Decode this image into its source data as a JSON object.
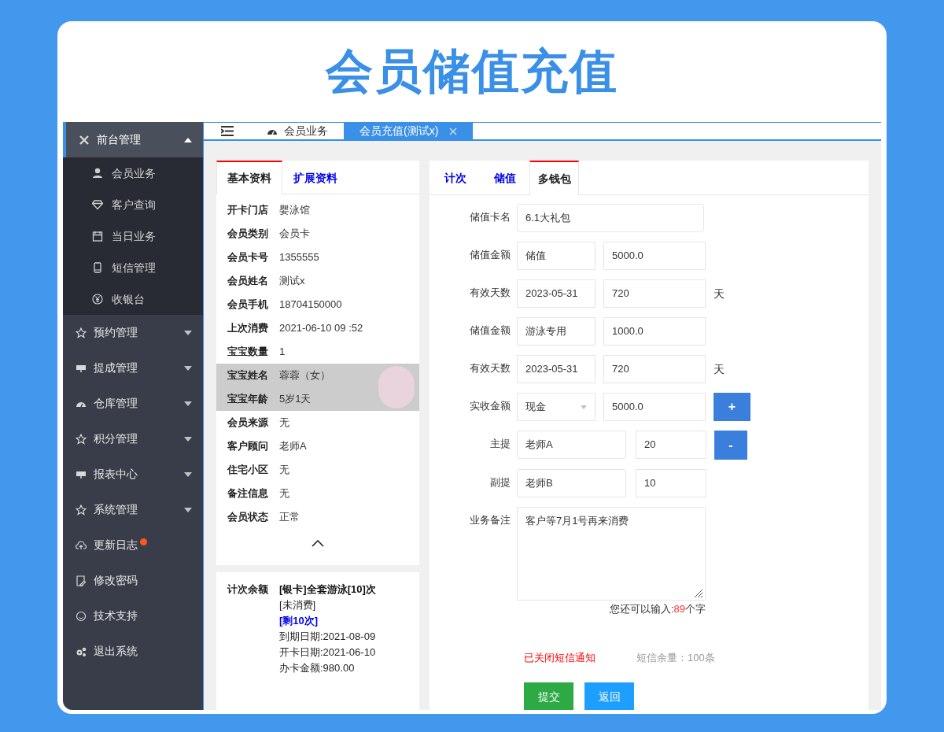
{
  "title": "会员储值充值",
  "sidebar": {
    "items": [
      {
        "label": "前台管理",
        "expanded": true,
        "dot": false,
        "children": [
          {
            "label": "会员业务"
          },
          {
            "label": "客户查询"
          },
          {
            "label": "当日业务"
          },
          {
            "label": "短信管理"
          },
          {
            "label": "收银台"
          }
        ]
      },
      {
        "label": "预约管理",
        "expanded": false,
        "dot": false
      },
      {
        "label": "提成管理",
        "expanded": false,
        "dot": false
      },
      {
        "label": "仓库管理",
        "expanded": false,
        "dot": false
      },
      {
        "label": "积分管理",
        "expanded": false,
        "dot": false
      },
      {
        "label": "报表中心",
        "expanded": false,
        "dot": false
      },
      {
        "label": "系统管理",
        "expanded": false,
        "dot": false
      },
      {
        "label": "更新日志",
        "dot": true
      },
      {
        "label": "修改密码",
        "dot": false
      },
      {
        "label": "技术支持",
        "dot": false
      },
      {
        "label": "退出系统",
        "dot": false
      }
    ]
  },
  "tabs": [
    {
      "label": "会员业务",
      "selected": false,
      "closable": false
    },
    {
      "label": "会员充值(测试x)",
      "selected": true,
      "closable": true
    }
  ],
  "member_panel": {
    "tabs": [
      {
        "label": "基本资料",
        "selected": true
      },
      {
        "label": "扩展资料",
        "selected": false
      }
    ],
    "fields": [
      {
        "label": "开卡门店",
        "value": "婴泳馆",
        "highlighted": false
      },
      {
        "label": "会员类别",
        "value": "会员卡",
        "highlighted": false
      },
      {
        "label": "会员卡号",
        "value": "1355555",
        "highlighted": false
      },
      {
        "label": "会员姓名",
        "value": "测试x",
        "highlighted": false
      },
      {
        "label": "会员手机",
        "value": "18704150000",
        "highlighted": false
      },
      {
        "label": "上次消费",
        "value": "2021-06-10 09 :52",
        "highlighted": false
      },
      {
        "label": "宝宝数量",
        "value": "1",
        "highlighted": false
      },
      {
        "label": "宝宝姓名",
        "value": "蓉蓉（女）",
        "highlighted": true
      },
      {
        "label": "宝宝年龄",
        "value": "5岁1天",
        "highlighted": true
      },
      {
        "label": "会员来源",
        "value": "无",
        "highlighted": false
      },
      {
        "label": "客户顾问",
        "value": "老师A",
        "highlighted": false
      },
      {
        "label": "住宅小区",
        "value": "无",
        "highlighted": false
      },
      {
        "label": "备注信息",
        "value": "无",
        "highlighted": false
      },
      {
        "label": "会员状态",
        "value": "正常",
        "highlighted": false
      }
    ],
    "balance": {
      "label": "计次余额",
      "lines": [
        {
          "text": "[银卡]全套游泳[10]次",
          "kind": "bold"
        },
        {
          "text": "[未消费]",
          "kind": "normal"
        },
        {
          "text": "[剩10次]",
          "kind": "link"
        },
        {
          "text": "到期日期:2021-08-09",
          "kind": "normal"
        },
        {
          "text": "开卡日期:2021-06-10",
          "kind": "normal"
        },
        {
          "text": "办卡金额:980.00",
          "kind": "normal"
        }
      ]
    }
  },
  "recharge_panel": {
    "tabs": [
      {
        "label": "计次",
        "selected": false
      },
      {
        "label": "储值",
        "selected": false
      },
      {
        "label": "多钱包",
        "selected": true
      }
    ],
    "rows": [
      {
        "kind": "wide",
        "label": "储值卡名",
        "value": "6.1大礼包"
      },
      {
        "kind": "pair",
        "label": "储值金额",
        "values": [
          "储值",
          "5000.0"
        ]
      },
      {
        "kind": "pair",
        "label": "有效天数",
        "values": [
          "2023-05-31",
          "720"
        ],
        "unit": "天"
      },
      {
        "kind": "pair",
        "label": "储值金额",
        "values": [
          "游泳专用",
          "1000.0"
        ]
      },
      {
        "kind": "pair",
        "label": "有效天数",
        "values": [
          "2023-05-31",
          "720"
        ],
        "unit": "天"
      },
      {
        "kind": "select",
        "label": "实收金额",
        "values": [
          "现金",
          "5000.0"
        ],
        "button": "+"
      },
      {
        "kind": "staff",
        "label": "主提",
        "values": [
          "老师A",
          "20"
        ],
        "button": "-"
      },
      {
        "kind": "staff",
        "label": "副提",
        "values": [
          "老师B",
          "10"
        ]
      },
      {
        "kind": "textarea",
        "label": "业务备注",
        "value": "客户等7月1号再来消费",
        "counter": [
          "您还可以输入:",
          "89",
          "个字"
        ]
      }
    ],
    "sms_notice": "已关闭短信通知",
    "sms_balance": "短信余量：100条",
    "buttons": [
      {
        "label": "提交",
        "kind": "submit"
      },
      {
        "label": "返回",
        "kind": "back"
      }
    ]
  }
}
